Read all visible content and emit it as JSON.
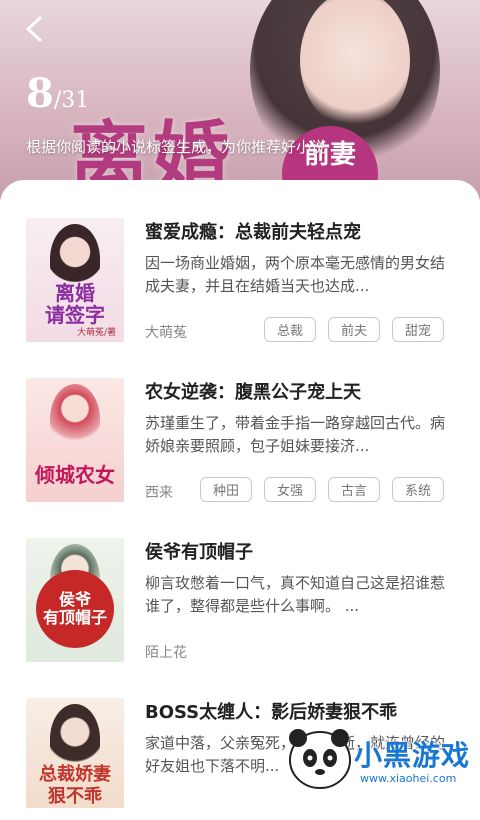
{
  "header": {
    "counter_current": "8",
    "counter_total": "/31",
    "subtitle": "根据你阅读的小说标签生成，为你推荐好小说",
    "cover_title": "离婚",
    "cover_badge": "前妻"
  },
  "books": [
    {
      "title": "蜜爱成瘾：总裁前夫轻点宠",
      "desc": "因一场商业婚姻，两个原本毫无感情的男女结成夫妻，并且在结婚当天也达成...",
      "author": "大萌菟",
      "tags": [
        "总裁",
        "前夫",
        "甜宠"
      ],
      "cover_title": "离婚\n请签字",
      "cover_author": "大萌菟/著"
    },
    {
      "title": "农女逆袭：腹黑公子宠上天",
      "desc": "苏瑾重生了，带着金手指一路穿越回古代。病娇娘亲要照顾，包子姐妹要接济...",
      "author": "西来",
      "tags": [
        "种田",
        "女强",
        "古言",
        "系统"
      ],
      "cover_title": "倾城农女",
      "cover_author": ""
    },
    {
      "title": "侯爷有顶帽子",
      "desc": "柳言玫憋着一口气，真不知道自己这是招谁惹谁了，整得都是些什么事啊。 ...",
      "author": "陌上花",
      "tags": [],
      "cover_title": "侯爷\n有顶帽子",
      "cover_author": ""
    },
    {
      "title": "BOSS太缠人：影后娇妻狠不乖",
      "desc": "家道中落，父亲冤死，母亲病逝，就连曾经的好友姐也下落不明...",
      "author": "",
      "tags": [],
      "cover_title": "总裁娇妻\n狠不乖",
      "cover_author": ""
    }
  ],
  "watermark": {
    "text": "小黑游戏",
    "url": "www.xiaohei.com"
  },
  "colors": {
    "accent": "#b0307a",
    "tag_border": "#c9c9c9"
  }
}
